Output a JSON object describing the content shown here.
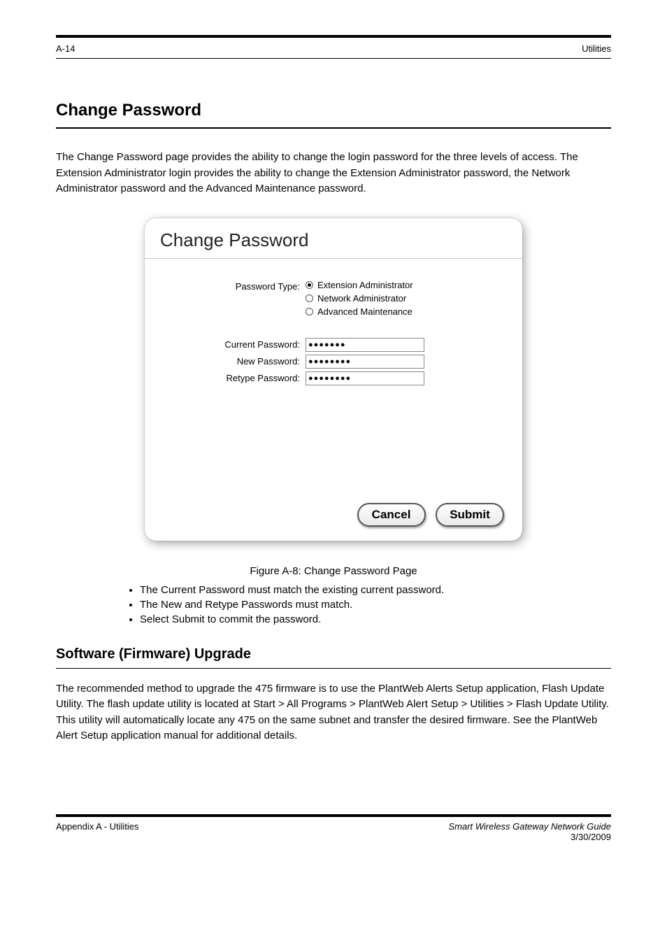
{
  "header": {
    "left": "A-14",
    "right": "Utilities"
  },
  "chapter": {
    "title": "Change Password",
    "intro": "The Change Password page provides the ability to change the login password for the three levels of access. The Extension Administrator login provides the ability to change the Extension Administrator password, the Network Administrator password and the Advanced Maintenance password."
  },
  "panel": {
    "title": "Change Password",
    "fields": {
      "type_label": "Password Type:",
      "radios": [
        {
          "label": "Extension Administrator",
          "selected": true
        },
        {
          "label": "Network Administrator",
          "selected": false
        },
        {
          "label": "Advanced Maintenance",
          "selected": false
        }
      ],
      "current_label": "Current Password:",
      "current_value": "●●●●●●●",
      "new_label": "New Password:",
      "new_value": "●●●●●●●●",
      "retype_label": "Retype Password:",
      "retype_value": "●●●●●●●●"
    },
    "buttons": {
      "cancel": "Cancel",
      "submit": "Submit"
    }
  },
  "figure_caption": "Figure A-8:  Change Password Page",
  "bullets": [
    "The Current Password must match the existing current password.",
    "The New and Retype Passwords must match.",
    "Select Submit to commit the password."
  ],
  "section2": {
    "title": "Software (Firmware) Upgrade",
    "text": "The recommended method to upgrade the 475 firmware is to use the PlantWeb Alerts Setup application, Flash Update Utility. The flash update utility is located at Start > All Programs > PlantWeb Alert Setup > Utilities > Flash Update Utility. This utility will automatically locate any 475 on the same subnet and transfer the desired firmware. See the PlantWeb Alert Setup application manual for additional details."
  },
  "footer": {
    "left": "Appendix A - Utilities",
    "right_guide": "Smart Wireless Gateway Network Guide",
    "right_date": "3/30/2009"
  }
}
